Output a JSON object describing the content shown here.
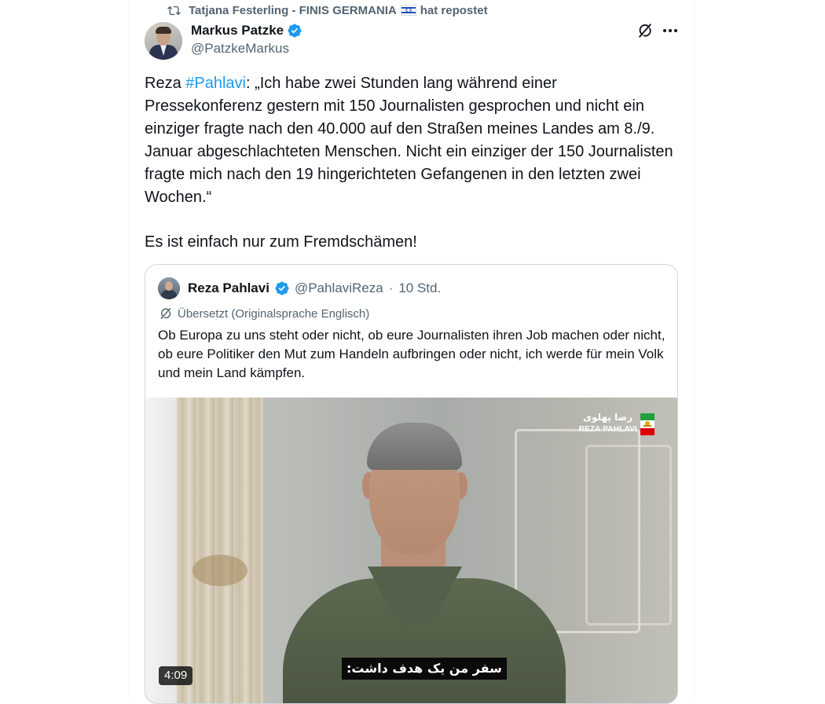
{
  "repost": {
    "icon": "repost-icon",
    "user": "Tatjana Festerling - FINIS GERMANIA",
    "flag": "israel-flag-icon",
    "suffix": "hat repostet"
  },
  "author": {
    "name": "Markus Patzke",
    "handle": "@PatzkeMarkus",
    "verified": true
  },
  "actions": {
    "grok_icon": "grok-icon",
    "more_icon": "more-options-icon"
  },
  "tweet": {
    "text_before": "Reza ",
    "hashtag": "#Pahlavi",
    "text_after": ": „Ich habe zwei Stunden lang während einer Pressekonferenz gestern mit 150 Journalisten gesprochen und nicht ein einziger fragte nach den 40.000 auf den Straßen meines Landes am 8./9. Januar abgeschlachteten Menschen. Nicht ein einziger der 150 Journalisten fragte mich nach den 19 hingerichteten Gefangenen in den letzten zwei Wochen.“",
    "paragraph2": "Es ist einfach nur zum Fremdschämen!"
  },
  "quote": {
    "name": "Reza Pahlavi",
    "handle": "@PahlaviReza",
    "separator": "·",
    "time": "10 Std.",
    "translated_label": "Übersetzt (Originalsprache Englisch)",
    "text": "Ob Europa zu uns steht oder nicht, ob eure Journalisten ihren Job machen oder nicht, ob eure Politiker den Mut zum Handeln aufbringen oder nicht, ich werde für mein Volk und mein Land kämpfen.",
    "media": {
      "duration": "4:09",
      "subtitle": "سفر من یک هدف داشت:",
      "logo_fa": "رضا پهلوی",
      "logo_en": "REZA PAHLAVI"
    }
  },
  "colors": {
    "link": "#1d9bf0",
    "verified": "#1d9bf0",
    "secondary_text": "#536471",
    "border": "#cfd9de"
  }
}
